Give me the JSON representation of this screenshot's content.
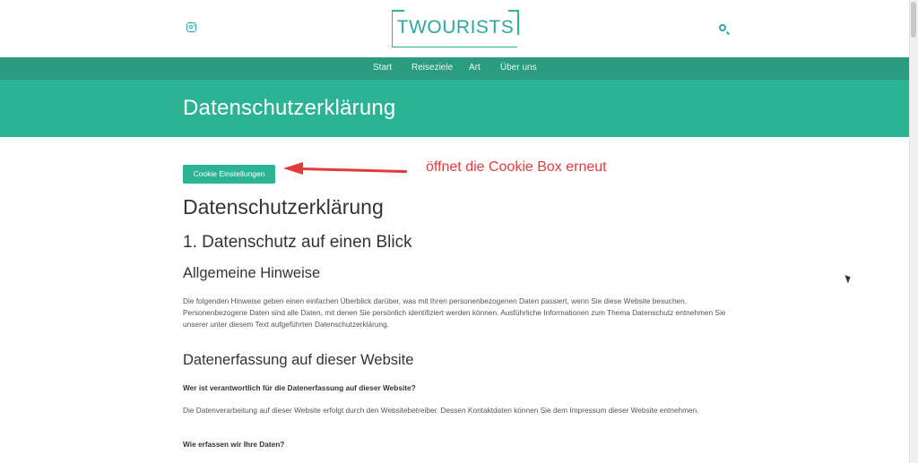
{
  "header": {
    "logo_text": "TWOURISTS",
    "icons": {
      "left": "instagram-icon",
      "right": "search-icon"
    }
  },
  "nav": {
    "items": [
      "Start",
      "Reiseziele",
      "Art",
      "Über uns"
    ]
  },
  "hero": {
    "title": "Datenschutzerklärung"
  },
  "cookie_button": {
    "label": "Cookie Einstellungen"
  },
  "annotation": {
    "text": "öffnet die Cookie Box erneut",
    "color": "#e23b3b"
  },
  "content": {
    "h1": "Datenschutzerklärung",
    "h2": "1. Datenschutz auf einen Blick",
    "section1_title": "Allgemeine Hinweise",
    "section1_text": "Die folgenden Hinweise geben einen einfachen Überblick darüber, was mit Ihren personenbezogenen Daten passiert, wenn Sie diese Website besuchen. Personenbezogene Daten sind alle Daten, mit denen Sie persönlich identifiziert werden können. Ausführliche Informationen zum Thema Datenschutz entnehmen Sie unserer unter diesem Text aufgeführten Datenschutzerklärung.",
    "section2_title": "Datenerfassung auf dieser Website",
    "q1": "Wer ist verantwortlich für die Datenerfassung auf dieser Website?",
    "q1_text": "Die Datenverarbeitung auf dieser Website erfolgt durch den Websitebetreiber. Dessen Kontaktdaten können Sie dem Impressum dieser Website entnehmen.",
    "q2": "Wie erfassen wir Ihre Daten?"
  },
  "colors": {
    "accent": "#2bb393",
    "nav_bg": "#2a9d80",
    "icon": "#2aa7b8"
  }
}
